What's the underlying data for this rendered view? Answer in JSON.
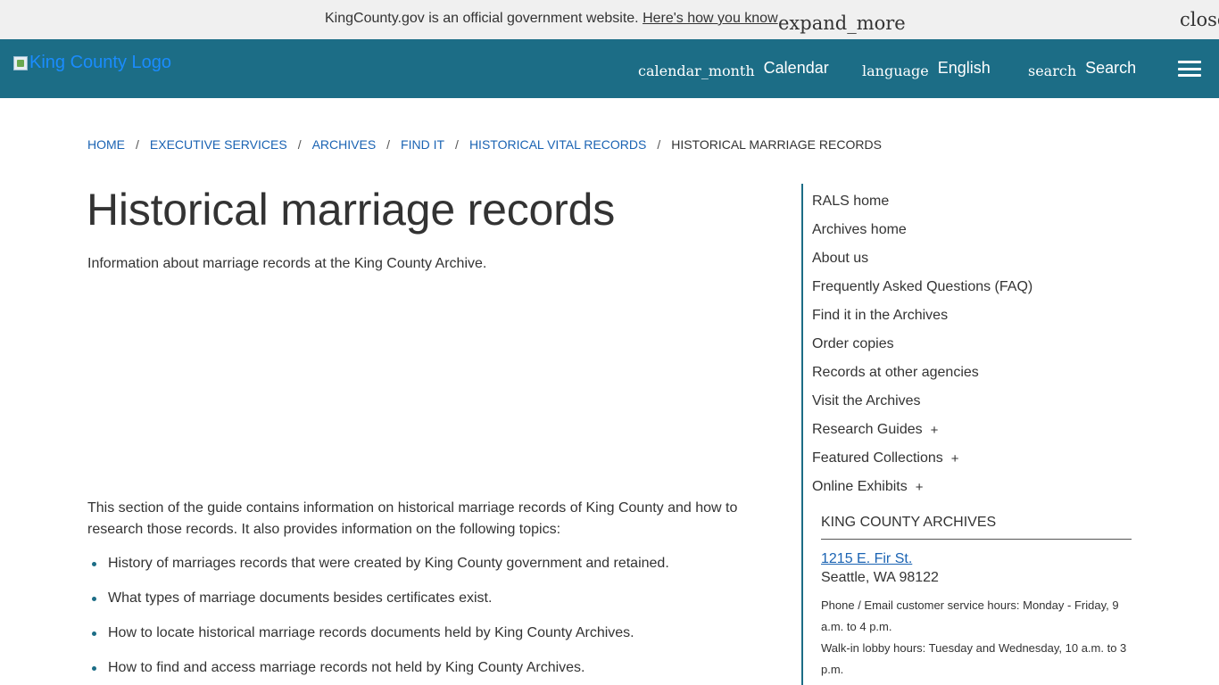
{
  "gov_banner": {
    "message": "KingCounty.gov is an official government website.",
    "link_text": "Here's how you know",
    "expand_icon_text": "expand_more",
    "close_icon_text": "close"
  },
  "header": {
    "logo_alt": "King County Logo",
    "nav": [
      {
        "icon": "calendar_month",
        "label": "Calendar"
      },
      {
        "icon": "language",
        "label": "English"
      },
      {
        "icon": "search",
        "label": "Search"
      }
    ],
    "colors": {
      "header_bg": "#1c6d86",
      "link": "#1a63b3"
    }
  },
  "breadcrumb": {
    "items": [
      "Home",
      "Executive Services",
      "Archives",
      "Find it",
      "Historical Vital Records"
    ],
    "current": "Historical marriage records",
    "separator": "/"
  },
  "main": {
    "title": "Historical marriage records",
    "intro": "Information about marriage records at the King County Archive.",
    "section_text": "This section of the guide contains information on historical marriage records of King County and how to research those records. It also provides information on the following topics:",
    "topics": [
      "History of marriages records that were created by King County government and retained.",
      "What types of marriage documents besides certificates exist.",
      "How to locate historical marriage records documents held by King County Archives.",
      "How to find and access marriage records not held by King County Archives."
    ]
  },
  "side_nav": {
    "items": [
      {
        "label": "RALS home",
        "plus": ""
      },
      {
        "label": "Archives home",
        "plus": ""
      },
      {
        "label": "About us",
        "plus": ""
      },
      {
        "label": "Frequently Asked Questions (FAQ)",
        "plus": ""
      },
      {
        "label": "Find it in the Archives",
        "plus": ""
      },
      {
        "label": "Order copies",
        "plus": ""
      },
      {
        "label": "Records at other agencies",
        "plus": ""
      },
      {
        "label": "Visit the Archives",
        "plus": ""
      },
      {
        "label": "Research Guides",
        "plus": "+"
      },
      {
        "label": "Featured Collections",
        "plus": "+"
      },
      {
        "label": "Online Exhibits",
        "plus": "+"
      }
    ],
    "contact": {
      "heading": "King County Archives",
      "address_line1": "1215 E. Fir St.",
      "address_line2": "Seattle, WA 98122",
      "hours1": "Phone / Email customer service hours: Monday - Friday, 9 a.m. to 4 p.m.",
      "hours2": "Walk-in lobby hours: Tuesday and Wednesday, 10 a.m. to 3 p.m."
    }
  }
}
